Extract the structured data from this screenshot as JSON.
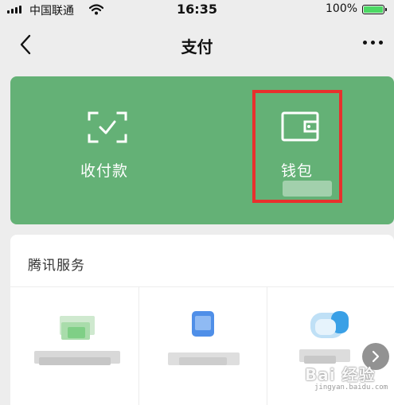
{
  "status_bar": {
    "carrier": "中国联通",
    "time": "16:35",
    "battery_percent": "100%",
    "battery_level": 1.0,
    "icons": [
      "signal-icon",
      "wifi-icon",
      "battery-icon"
    ]
  },
  "nav": {
    "title": "支付",
    "back_icon": "chevron-left-icon",
    "more_icon": "more-icon"
  },
  "pay_card": {
    "background_color": "#64b176",
    "receive": {
      "label": "收付款",
      "icon": "scan-check-icon"
    },
    "wallet": {
      "label": "钱包",
      "icon": "wallet-icon"
    },
    "highlight_color": "#e8302d"
  },
  "services": {
    "title": "腾讯服务",
    "items": [
      {
        "icon": "service-green-icon"
      },
      {
        "icon": "service-phone-icon"
      },
      {
        "icon": "service-cloud-icon"
      }
    ],
    "next_icon": "chevron-right-icon"
  },
  "watermark": {
    "main": "Bai 经验",
    "sub": "jingyan.baidu.com"
  }
}
